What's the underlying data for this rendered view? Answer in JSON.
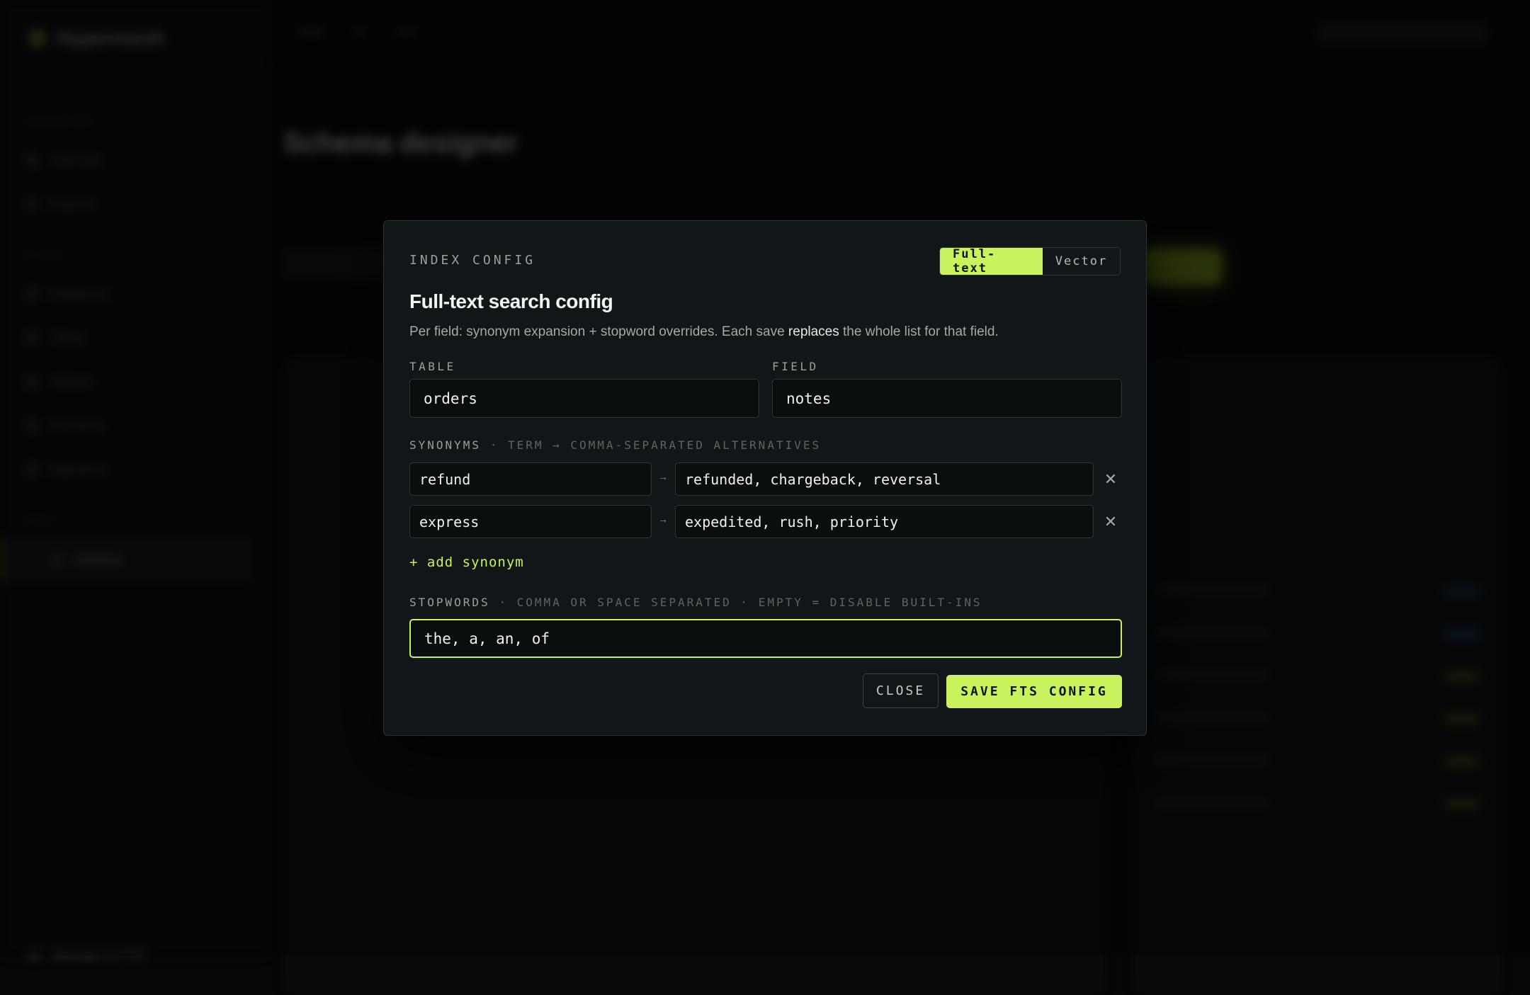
{
  "background": {
    "app_name": "Hypermesh",
    "nav_sections": [
      {
        "title": "WORKSPACE",
        "items": [
          "Overview",
          "Explorer"
        ]
      },
      {
        "title": "BUILD",
        "items": [
          "Databases",
          "Tables",
          "Indexes",
          "Functions",
          "Migrations"
        ]
      },
      {
        "title": "DATA",
        "items": [
          "Schema"
        ]
      }
    ],
    "nav_bottom": "Backups & PITR",
    "page_title": "Schema designer"
  },
  "modal": {
    "eyebrow": "INDEX CONFIG",
    "mode_tabs": [
      {
        "label": "Full-text",
        "active": true
      },
      {
        "label": "Vector",
        "active": false
      }
    ],
    "title": "Full-text search config",
    "description_pre": "Per field: synonym expansion + stopword overrides. Each save ",
    "description_em": "replaces",
    "description_post": " the whole list for that field.",
    "table": {
      "label": "TABLE",
      "value": "orders"
    },
    "field": {
      "label": "FIELD",
      "value": "notes"
    },
    "synonyms_label": "SYNONYMS",
    "synonyms_hint": " · TERM → COMMA-SEPARATED ALTERNATIVES",
    "synonyms": [
      {
        "term": "refund",
        "alternatives": "refunded, chargeback, reversal"
      },
      {
        "term": "express",
        "alternatives": "expedited, rush, priority"
      }
    ],
    "arrow": "→",
    "remove_glyph": "✕",
    "add_synonym_label": "+ add synonym",
    "stopwords_label": "STOPWORDS",
    "stopwords_hint": " · COMMA OR SPACE SEPARATED · EMPTY = DISABLE BUILT-INS",
    "stopwords_value": "the, a, an, of",
    "close_label": "CLOSE",
    "save_label": "SAVE FTS CONFIG"
  },
  "colors": {
    "accent": "#c9f25c",
    "modal_bg": "#111618",
    "input_bg": "#0b0e0f"
  }
}
